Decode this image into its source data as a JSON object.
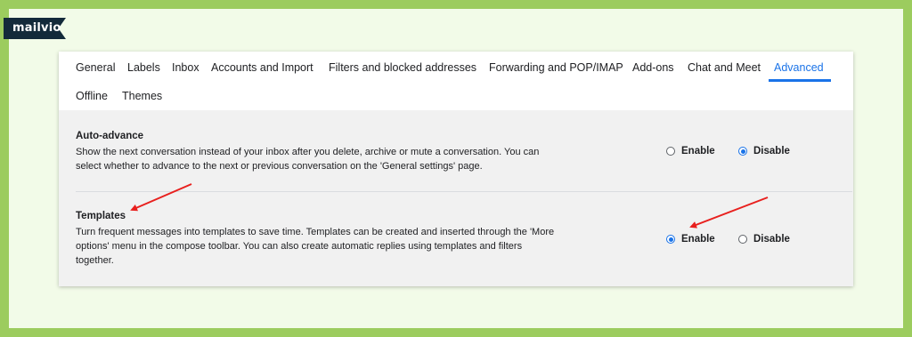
{
  "logo": {
    "text": "mailvio"
  },
  "tabs": [
    {
      "label": "General",
      "active": false
    },
    {
      "label": "Labels",
      "active": false
    },
    {
      "label": "Inbox",
      "active": false
    },
    {
      "label": "Accounts and Import",
      "active": false
    },
    {
      "label": "Filters and blocked addresses",
      "active": false
    },
    {
      "label": "Forwarding and POP/IMAP",
      "active": false
    },
    {
      "label": "Add-ons",
      "active": false
    },
    {
      "label": "Chat and Meet",
      "active": false
    },
    {
      "label": "Advanced",
      "active": true
    },
    {
      "label": "Offline",
      "active": false
    },
    {
      "label": "Themes",
      "active": false
    }
  ],
  "settings": {
    "auto_advance": {
      "title": "Auto-advance",
      "desc_line1": "Show the next conversation instead of your inbox after you delete, archive or mute a conversation. You can",
      "desc_line2": "select whether to advance to the next or previous conversation on the 'General settings' page.",
      "enable_label": "Enable",
      "disable_label": "Disable",
      "selected": "Disable"
    },
    "templates": {
      "title": "Templates",
      "desc_line1": "Turn frequent messages into templates to save time. Templates can be created and inserted through the 'More",
      "desc_line2": "options' menu in the compose toolbar. You can also create automatic replies using templates and filters",
      "desc_line3": "together.",
      "enable_label": "Enable",
      "disable_label": "Disable",
      "selected": "Enable"
    }
  },
  "colors": {
    "accent": "#1a73e8",
    "frame": "#9ccc5e",
    "arrow": "#e8201e"
  }
}
